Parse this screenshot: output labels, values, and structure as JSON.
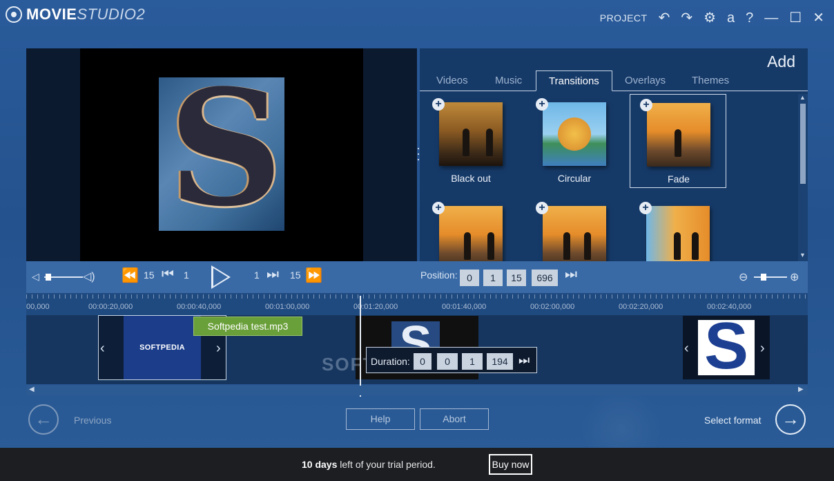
{
  "app": {
    "logo_main": "MOVIE",
    "logo_sub": "STUDIO2"
  },
  "titlebar": {
    "project": "PROJECT",
    "undo_icon": "undo-icon",
    "redo_icon": "redo-icon",
    "settings_icon": "gear-icon",
    "account_glyph": "a",
    "help_glyph": "?",
    "minimize_glyph": "—",
    "maximize_glyph": "☐",
    "close_glyph": "✕"
  },
  "add_panel": {
    "title": "Add",
    "tabs": [
      {
        "label": "Videos",
        "active": false
      },
      {
        "label": "Music",
        "active": false
      },
      {
        "label": "Transitions",
        "active": true
      },
      {
        "label": "Overlays",
        "active": false
      },
      {
        "label": "Themes",
        "active": false
      }
    ],
    "transitions": [
      {
        "label": "Black out",
        "selected": false
      },
      {
        "label": "Circular",
        "selected": false
      },
      {
        "label": "Fade",
        "selected": true
      },
      {
        "label": "",
        "selected": false
      },
      {
        "label": "",
        "selected": false
      },
      {
        "label": "",
        "selected": false
      }
    ]
  },
  "transport": {
    "skip_back_frames": "15",
    "step_back_frames": "1",
    "step_forward_frames": "1",
    "skip_forward_frames": "15",
    "position_label": "Position:",
    "position": {
      "hours": "0",
      "minutes": "1",
      "seconds": "15",
      "frames": "696"
    },
    "volume_level": 0.1,
    "zoom_level": 0.3
  },
  "timeline": {
    "ruler_labels": [
      "00,000",
      "00:00:20,000",
      "00:00:40,000",
      "00:01:00,000",
      "00:01:20,000",
      "00:01:40,000",
      "00:02:00,000",
      "00:02:20,000",
      "00:02:40,000"
    ],
    "audio_clip": "Softpedia test.mp3",
    "video_clip_text": "SOFTPEDIA",
    "duration_label": "Duration:",
    "duration": {
      "hours": "0",
      "minutes": "0",
      "seconds": "1",
      "frames": "194"
    },
    "watermark": "SOFTPEDIA"
  },
  "nav": {
    "previous": "Previous",
    "help": "Help",
    "abort": "Abort",
    "next": "Select format"
  },
  "trial": {
    "days": "10 days",
    "suffix": " left of your trial period.",
    "buy": "Buy now"
  },
  "colors": {
    "background": "#1f4f8c",
    "audio_clip": "#6aa03a",
    "trial_bar": "#1c1e22"
  }
}
